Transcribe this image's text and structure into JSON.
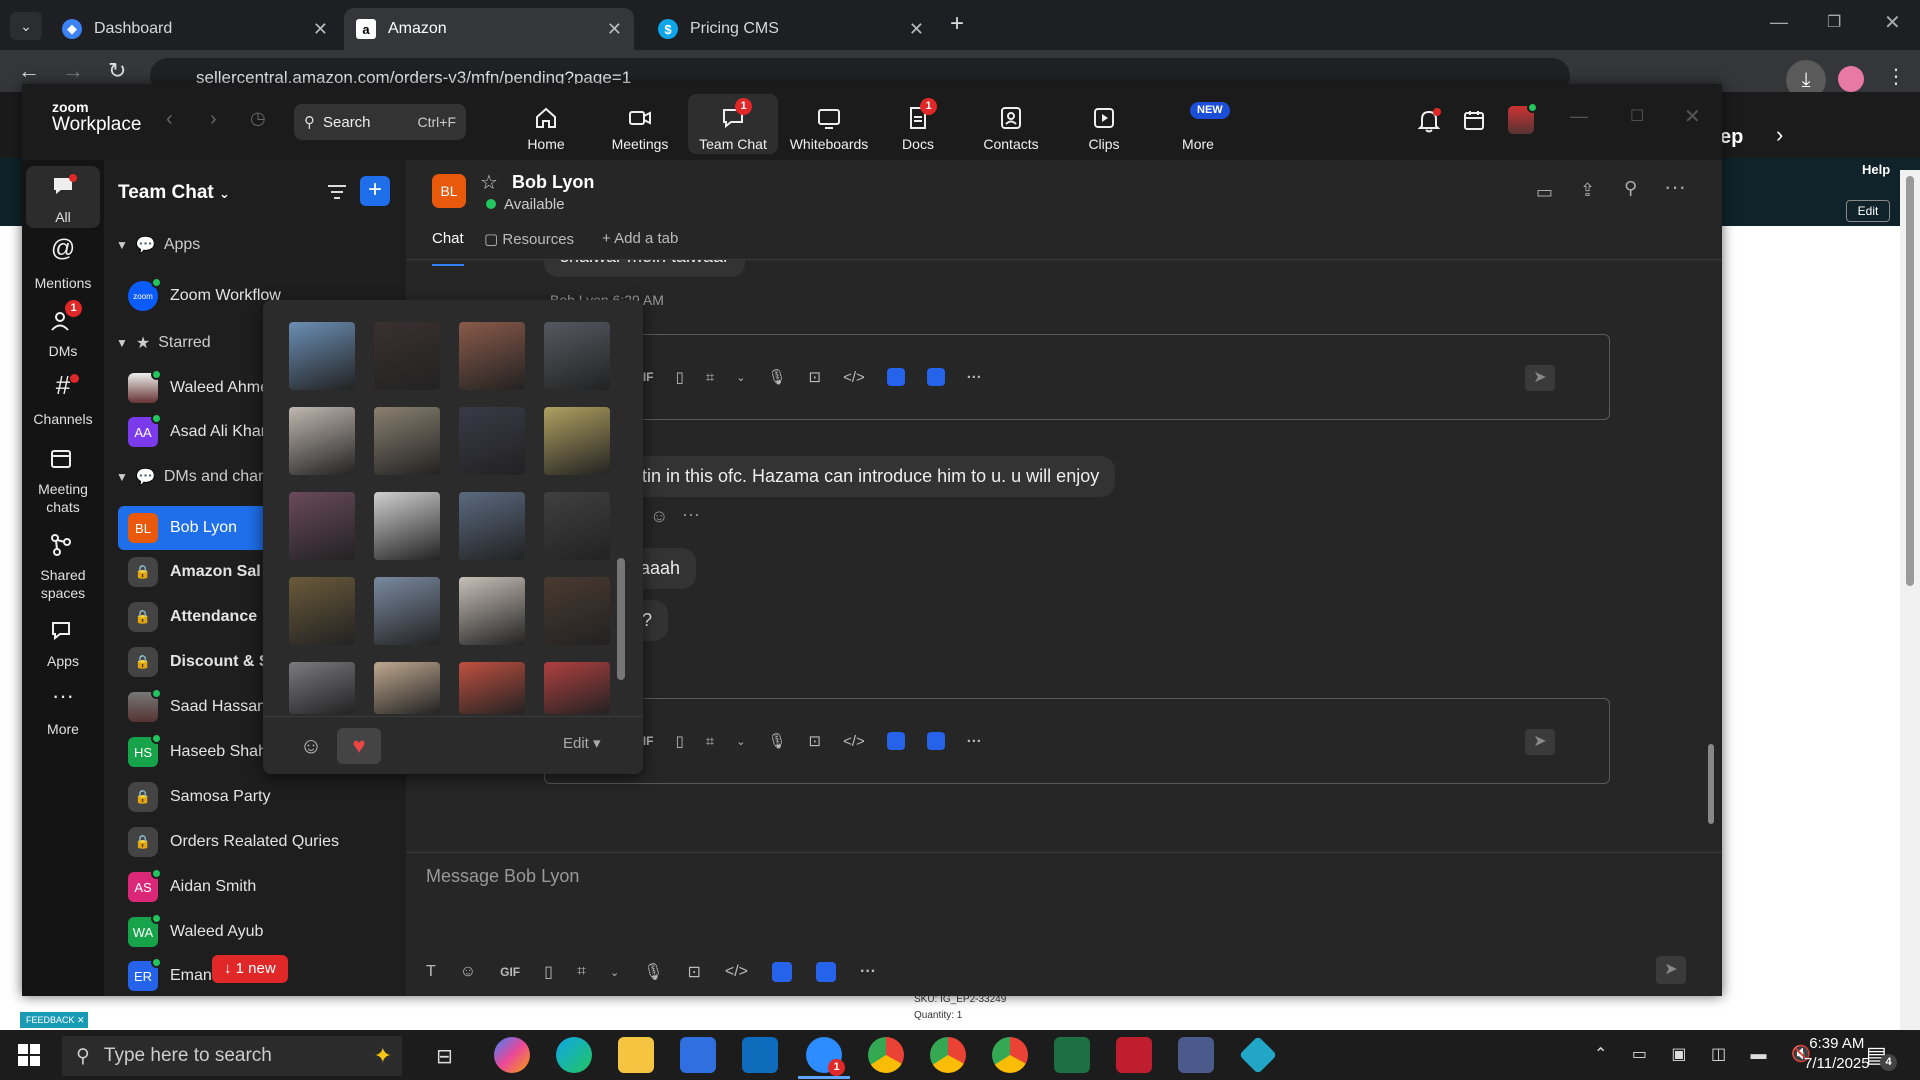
{
  "browser": {
    "tabs": [
      {
        "title": "Dashboard",
        "favicon": "dashboard-icon"
      },
      {
        "title": "Amazon",
        "favicon": "amazon-icon"
      },
      {
        "title": "Pricing CMS",
        "favicon": "dollar-icon"
      }
    ],
    "url": "sellercentral.amazon.com/orders-v3/mfn/pending?page=1"
  },
  "zoom": {
    "logo_top": "zoom",
    "logo_bottom": "Workplace",
    "search": {
      "label": "Search",
      "shortcut": "Ctrl+F"
    },
    "nav": [
      {
        "label": "Home",
        "icon": "home-icon"
      },
      {
        "label": "Meetings",
        "icon": "video-icon"
      },
      {
        "label": "Team Chat",
        "icon": "chat-icon",
        "badge": "1"
      },
      {
        "label": "Whiteboards",
        "icon": "whiteboard-icon"
      },
      {
        "label": "Docs",
        "icon": "docs-icon",
        "badge": "1"
      },
      {
        "label": "Contacts",
        "icon": "contacts-icon"
      },
      {
        "label": "Clips",
        "icon": "clips-icon"
      },
      {
        "label": "More",
        "icon": "more-icon",
        "badge": "NEW"
      }
    ],
    "rail": [
      {
        "label": "All",
        "icon": "chat-bubble-icon"
      },
      {
        "label": "Mentions",
        "icon": "at-icon"
      },
      {
        "label": "DMs",
        "icon": "people-icon",
        "badge": "1"
      },
      {
        "label": "Channels",
        "icon": "hash-icon"
      },
      {
        "label": "Meeting chats",
        "icon": "calendar-icon"
      },
      {
        "label": "Shared spaces",
        "icon": "share-icon"
      },
      {
        "label": "Apps",
        "icon": "apps-icon"
      },
      {
        "label": "More",
        "icon": "ellipsis-icon"
      }
    ],
    "sidebar": {
      "title": "Team Chat",
      "sections": {
        "apps": "Apps",
        "starred": "Starred",
        "dms": "DMs and chann"
      },
      "items": [
        {
          "label": "Zoom Workflow",
          "initials": "zoom",
          "color": "#0b5cff"
        },
        {
          "label": "Waleed Ahme",
          "initials": "",
          "color": "#5a3a2a"
        },
        {
          "label": "Asad Ali Khan",
          "initials": "AA",
          "color": "#7c3aed"
        },
        {
          "label": "Bob Lyon",
          "initials": "BL",
          "color": "#e8590c"
        },
        {
          "label": "Amazon Sal",
          "initials": "",
          "color": "#444444"
        },
        {
          "label": "Attendance",
          "initials": "",
          "color": "#444444"
        },
        {
          "label": "Discount & S",
          "initials": "",
          "color": "#444444"
        },
        {
          "label": "Saad Hassan",
          "initials": "",
          "color": "#6b4a3a"
        },
        {
          "label": "Haseeb Shah",
          "initials": "HS",
          "color": "#16a34a"
        },
        {
          "label": "Samosa Party",
          "initials": "",
          "color": "#444444"
        },
        {
          "label": "Orders Realated Quries",
          "initials": "",
          "color": "#444444"
        },
        {
          "label": "Aidan Smith",
          "initials": "AS",
          "color": "#db2777"
        },
        {
          "label": "Waleed Ayub",
          "initials": "WA",
          "color": "#16a34a"
        },
        {
          "label": "Eman",
          "initials": "ER",
          "color": "#2563eb"
        }
      ],
      "new_badge": "1 new"
    },
    "chat": {
      "name": "Bob Lyon",
      "initials": "BL",
      "status": "Available",
      "tabs": [
        "Chat",
        "Resources",
        "Add a tab"
      ],
      "messages": [
        {
          "text": "shalwar mein talwaar"
        },
        {
          "text": "Bob Lyon 6:29 AM"
        },
        {
          "text": "rtin in this ofc. Hazama can introduce him to u. u will enjoy"
        },
        {
          "text": "aaaah"
        },
        {
          "text": "di?"
        }
      ],
      "composer_placeholder": "Message Bob Lyon"
    },
    "picker": {
      "edit_label": "Edit",
      "stickers": [
        "#6b8fb5",
        "#3a3030",
        "#8a5a4a",
        "#555a60",
        "#c0b8b0",
        "#8a8070",
        "#3a3a48",
        "#b0a060",
        "#6a4a5a",
        "#d0d0d0",
        "#5a6a80",
        "#404040",
        "#6a5a3a",
        "#7a8aa0",
        "#c8c0b8",
        "#4a3a30",
        "#7a7a80",
        "#c0a890",
        "#c05040",
        "#b04040"
      ]
    }
  },
  "amazon": {
    "help": "Help",
    "edit": "Edit",
    "ep": "ep",
    "sku": "SKU: IG_EP2-33249",
    "quantity": "Quantity: 1",
    "feedback": "FEEDBACK"
  },
  "taskbar": {
    "search_placeholder": "Type here to search",
    "time": "6:39 AM",
    "date": "7/11/2025",
    "notif_count": "4",
    "zoom_badge": "1"
  }
}
